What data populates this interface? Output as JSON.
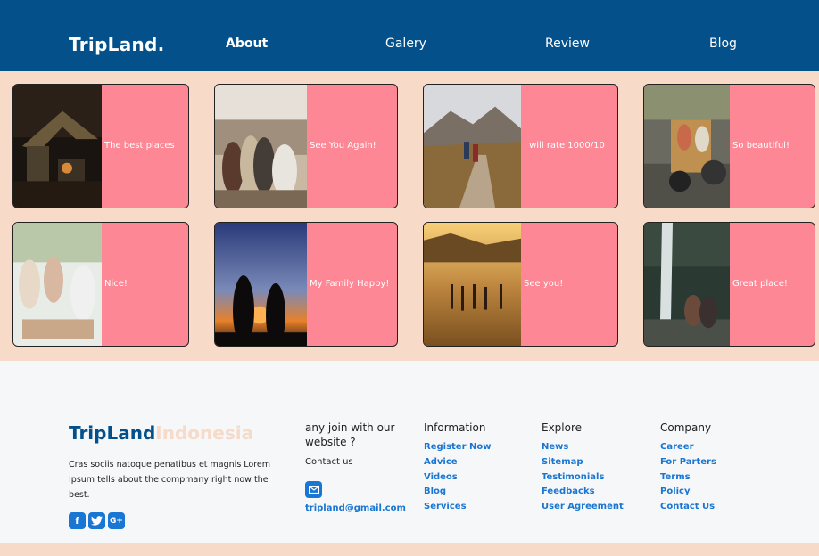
{
  "nav": {
    "brand": "TripLand.",
    "links": [
      {
        "label": "About",
        "active": true
      },
      {
        "label": "Galery",
        "active": false
      },
      {
        "label": "Review",
        "active": false
      },
      {
        "label": "Blog",
        "active": false
      }
    ]
  },
  "cards": [
    {
      "caption": "The best places",
      "image": "campsite-night-photo"
    },
    {
      "caption": "See You Again!",
      "image": "friends-sitting-photo"
    },
    {
      "caption": "I will rate 1000/10",
      "image": "hikers-trail-photo"
    },
    {
      "caption": "So beautiful!",
      "image": "street-tuktuk-photo"
    },
    {
      "caption": "Nice!",
      "image": "friends-toast-photo"
    },
    {
      "caption": "My Family Happy!",
      "image": "sunset-silhouette-photo"
    },
    {
      "caption": "See you!",
      "image": "beach-walkers-photo"
    },
    {
      "caption": "Great place!",
      "image": "waterfall-photo"
    }
  ],
  "footer": {
    "brand_main": "TripLand",
    "brand_accent": "Indonesia",
    "description": "Cras sociis natoque penatibus et magnis Lorem Ipsum tells about the compmany right now the best.",
    "socials": [
      "facebook-icon",
      "twitter-icon",
      "google-plus-icon"
    ],
    "join_title": "any join with our website ?",
    "contact_label": "Contact us",
    "email": "tripland@gmail.com",
    "columns": [
      {
        "title": "Information",
        "links": [
          "Register Now",
          "Advice",
          "Videos",
          "Blog",
          "Services"
        ]
      },
      {
        "title": "Explore",
        "links": [
          "News",
          "Sitemap",
          "Testimonials",
          "Feedbacks",
          "User Agreement"
        ]
      },
      {
        "title": "Company",
        "links": [
          "Career",
          "For Parters",
          "Terms",
          "Policy",
          "Contact Us"
        ]
      }
    ]
  },
  "colors": {
    "nav_bg": "#03508b",
    "page_bg": "#f7dac8",
    "card_bg": "#fe8795",
    "link": "#1976d2"
  }
}
